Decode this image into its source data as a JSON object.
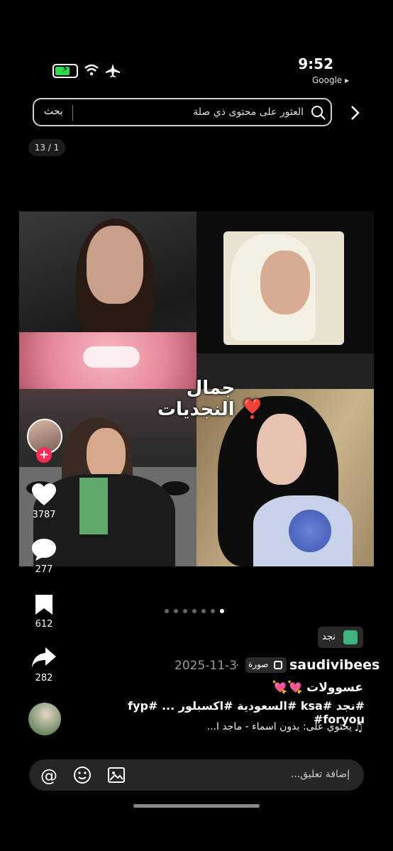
{
  "status_bar": {
    "time": "9:52",
    "back_to_app": "Google ▸",
    "battery_color": "#32d74b"
  },
  "search": {
    "placeholder": "العثور على محتوى ذي صلة",
    "button_label": "بحث"
  },
  "page_counter": "13 / 1",
  "collage": {
    "caption": "جمال النجديات ❣️"
  },
  "actions": {
    "likes": "3787",
    "comments": "277",
    "bookmarks": "612",
    "shares": "282",
    "follow_label": "+"
  },
  "pagination": {
    "total": 7,
    "active_index": 6
  },
  "post": {
    "location": "نجد",
    "username": "saudivibees",
    "type": "صورة",
    "date": "2025-11-3",
    "date_separator": "·",
    "caption": "عسوولات 💘💘",
    "hashtags": "#نجد #ksa #السعودية #اكسبلور ... #fyp #foryou",
    "music": "يحتوي على: بدون اسماء - ماجد ا..."
  },
  "comment_bar": {
    "placeholder": "إضافة تعليق..."
  },
  "icons": {
    "mention": "@",
    "music": "♫"
  },
  "colors": {
    "background": "#000000",
    "follow": "#fe2c55",
    "location_icon": "#3fb37f"
  }
}
